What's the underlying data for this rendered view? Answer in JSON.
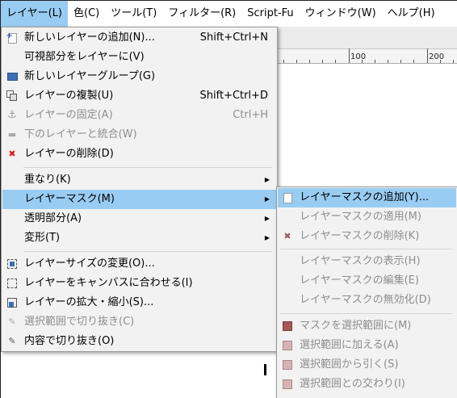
{
  "menubar": {
    "items": [
      {
        "label": "レイヤー(L)",
        "active": true
      },
      {
        "label": "色(C)"
      },
      {
        "label": "ツール(T)"
      },
      {
        "label": "フィルター(R)"
      },
      {
        "label": "Script-Fu"
      },
      {
        "label": "ウィンドウ(W)"
      },
      {
        "label": "ヘルプ(H)"
      }
    ]
  },
  "ruler": {
    "labels": [
      "100",
      "200"
    ]
  },
  "layer_menu": {
    "items": [
      {
        "label": "新しいレイヤーの追加(N)...",
        "shortcut": "Shift+Ctrl+N",
        "icon": "new-layer-icon",
        "enabled": true
      },
      {
        "label": "可視部分をレイヤーに(V)",
        "shortcut": "",
        "icon": "",
        "enabled": true
      },
      {
        "label": "新しいレイヤーグループ(G)",
        "shortcut": "",
        "icon": "new-layer-group-icon",
        "enabled": true
      },
      {
        "label": "レイヤーの複製(U)",
        "shortcut": "Shift+Ctrl+D",
        "icon": "duplicate-layer-icon",
        "enabled": true
      },
      {
        "label": "レイヤーの固定(A)",
        "shortcut": "Ctrl+H",
        "icon": "anchor-icon",
        "enabled": false
      },
      {
        "label": "下のレイヤーと統合(W)",
        "shortcut": "",
        "icon": "merge-down-icon",
        "enabled": false
      },
      {
        "label": "レイヤーの削除(D)",
        "shortcut": "",
        "icon": "delete-icon",
        "enabled": true
      },
      {
        "label": "重なり(K)",
        "submenu": true,
        "enabled": true
      },
      {
        "label": "レイヤーマスク(M)",
        "submenu": true,
        "enabled": true,
        "highlighted": true
      },
      {
        "label": "透明部分(A)",
        "submenu": true,
        "enabled": true
      },
      {
        "label": "変形(T)",
        "submenu": true,
        "enabled": true
      },
      {
        "label": "レイヤーサイズの変更(O)...",
        "icon": "layer-boundary-icon",
        "enabled": true
      },
      {
        "label": "レイヤーをキャンバスに合わせる(I)",
        "icon": "fit-canvas-icon",
        "enabled": true
      },
      {
        "label": "レイヤーの拡大・縮小(S)...",
        "icon": "scale-layer-icon",
        "enabled": true
      },
      {
        "label": "選択範囲で切り抜き(C)",
        "icon": "crop-selection-icon",
        "enabled": false
      },
      {
        "label": "内容で切り抜き(O)",
        "icon": "crop-content-icon",
        "enabled": true
      }
    ]
  },
  "mask_submenu": {
    "items": [
      {
        "label": "レイヤーマスクの追加(Y)...",
        "icon": "add-mask-icon",
        "enabled": true,
        "highlighted": true
      },
      {
        "label": "レイヤーマスクの適用(M)",
        "enabled": false
      },
      {
        "label": "レイヤーマスクの削除(K)",
        "icon": "delete-mask-icon",
        "enabled": false
      },
      {
        "label": "レイヤーマスクの表示(H)",
        "enabled": false
      },
      {
        "label": "レイヤーマスクの編集(E)",
        "enabled": false
      },
      {
        "label": "レイヤーマスクの無効化(D)",
        "enabled": false
      },
      {
        "label": "マスクを選択範囲に(M)",
        "icon": "mask-to-selection-icon",
        "enabled": false
      },
      {
        "label": "選択範囲に加える(A)",
        "icon": "add-to-selection-icon",
        "enabled": false
      },
      {
        "label": "選択範囲から引く(S)",
        "icon": "subtract-selection-icon",
        "enabled": false
      },
      {
        "label": "選択範囲との交わり(I)",
        "icon": "intersect-selection-icon",
        "enabled": false
      }
    ]
  },
  "colors": {
    "highlight": "#99ccf3",
    "menu_bg": "#f2f2f2",
    "disabled_text": "#8d8d8d",
    "delete_red": "#d31d1d"
  }
}
